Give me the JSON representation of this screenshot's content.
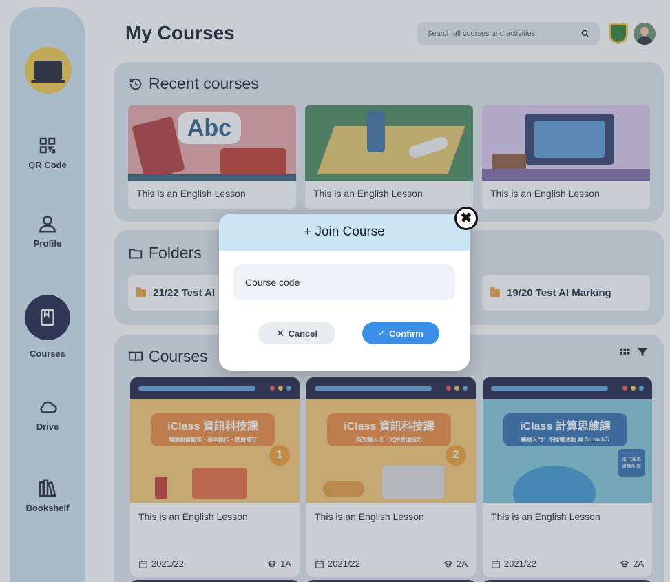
{
  "header": {
    "title": "My Courses",
    "search_placeholder": "Search all courses and activities"
  },
  "sidebar": {
    "items": [
      {
        "label": "QR Code",
        "icon": "qr-code-icon"
      },
      {
        "label": "Profile",
        "icon": "user-icon"
      },
      {
        "label": "Courses",
        "icon": "book-icon",
        "active": true
      },
      {
        "label": "Drive",
        "icon": "cloud-icon"
      },
      {
        "label": "Bookshelf",
        "icon": "bookshelf-icon"
      }
    ]
  },
  "recent": {
    "title": "Recent courses",
    "cards": [
      {
        "caption": "This is an English Lesson",
        "art": "abc",
        "art_text": "Abc"
      },
      {
        "caption": "This is an English Lesson",
        "art": "science"
      },
      {
        "caption": "This is an English Lesson",
        "art": "computer"
      }
    ]
  },
  "folders": {
    "title": "Folders",
    "items": [
      {
        "label": "21/22 Test AI"
      },
      {
        "label": "19/20 Test AI Marking"
      }
    ]
  },
  "courses": {
    "title": "Courses",
    "cards": [
      {
        "banner": "iClass 資訊科技課",
        "subtitle": "電腦設備認知・基本操作・使用條守",
        "badge": "1",
        "title": "This is an English Lesson",
        "year": "2021/22",
        "class": "1A"
      },
      {
        "banner": "iClass 資訊科技課",
        "subtitle": "英文輸入法・文件管理技巧",
        "badge": "2",
        "title": "This is an English Lesson",
        "year": "2021/22",
        "class": "2A"
      },
      {
        "banner": "iClass 計算思維課",
        "subtitle": "編程入門：不插電活動 與 ScratchJr",
        "badge": "電子課本 實體配套",
        "title": "This is an English Lesson",
        "year": "2021/22",
        "class": "2A"
      }
    ]
  },
  "modal": {
    "title": "+ Join Course",
    "input_placeholder": "Course code",
    "cancel_label": "Cancel",
    "confirm_label": "Confirm",
    "close_label": "✖"
  },
  "colors": {
    "sidebar_bg": "#cfe3f2",
    "active_nav": "#1d2145",
    "confirm": "#3d8ee6",
    "modal_header": "#cbe5f7",
    "folder_icon": "#e9a23b"
  }
}
